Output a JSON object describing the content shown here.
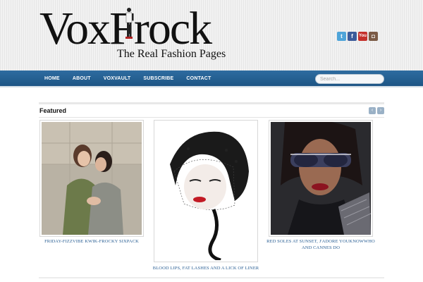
{
  "site": {
    "logo_text": "VoxFrock",
    "tagline": "The Real Fashion Pages"
  },
  "social": [
    {
      "name": "twitter",
      "glyph": "t"
    },
    {
      "name": "facebook",
      "glyph": "f"
    },
    {
      "name": "youtube",
      "glyph": "You"
    },
    {
      "name": "instagram",
      "glyph": "◘"
    }
  ],
  "nav": {
    "items": [
      "HOME",
      "ABOUT",
      "VOXVAULT",
      "SUBSCRIBE",
      "CONTACT"
    ]
  },
  "search": {
    "placeholder": "Search..."
  },
  "featured": {
    "title": "Featured",
    "posts": [
      {
        "caption": "FRIDAY-FIZZVIBE KWIK-FROCKY SIXPACK"
      },
      {
        "caption": "BLOOD LIPS, FAT LASHES AND A LICK OF LINER"
      },
      {
        "caption": "RED SOLES AT SUNSET, J'ADORE YOUKNOWWHO AND CANNES DO"
      }
    ]
  },
  "colors": {
    "nav_blue": "#1d5585",
    "link_blue": "#2a5f94"
  }
}
